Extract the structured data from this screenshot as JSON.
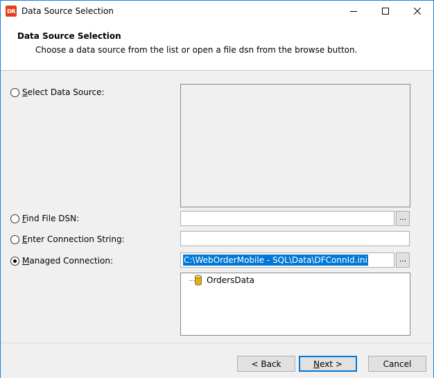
{
  "window": {
    "title": "Data Source Selection",
    "app_icon_text": "DR",
    "accent_color": "#0078d7"
  },
  "header": {
    "title": "Data Source Selection",
    "subtitle": "Choose a data source from the list or open a file dsn from the browse button."
  },
  "options": {
    "select_data_source": {
      "mnemonic": "S",
      "rest": "elect Data Source:",
      "checked": false
    },
    "find_file_dsn": {
      "mnemonic": "F",
      "rest": "ind File DSN:",
      "checked": false
    },
    "enter_connection_string": {
      "mnemonic": "E",
      "rest": "nter Connection String:",
      "checked": false
    },
    "managed_connection": {
      "mnemonic": "M",
      "rest": "anaged Connection:",
      "checked": true
    }
  },
  "fields": {
    "file_dsn_value": "",
    "connection_string_value": "",
    "managed_connection_value": "C:\\WebOrderMobile - SQL\\Data\\DFConnId.ini",
    "browse_label": "..."
  },
  "tree": {
    "items": [
      {
        "label": "OrdersData",
        "icon": "database-icon"
      }
    ]
  },
  "buttons": {
    "back": "< Back",
    "next_mnemonic": "N",
    "next_rest": "ext >",
    "cancel": "Cancel"
  }
}
